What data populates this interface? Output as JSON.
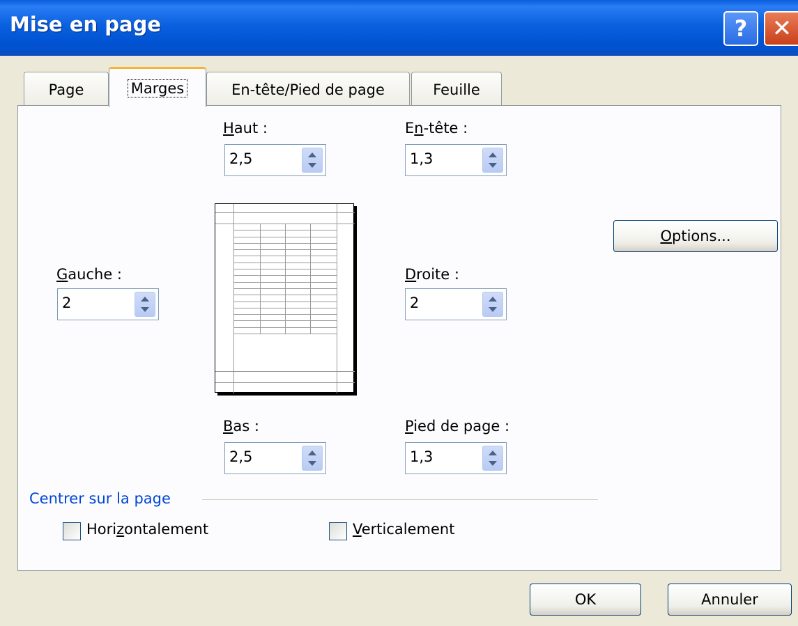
{
  "window": {
    "title": "Mise en page",
    "help_symbol": "?",
    "close_symbol": "✕"
  },
  "tabs": [
    {
      "label": "Page",
      "active": false
    },
    {
      "label": "Marges",
      "active": true
    },
    {
      "label": "En-tête/Pied de page",
      "active": false
    },
    {
      "label": "Feuille",
      "active": false
    }
  ],
  "margins": {
    "top": {
      "label_pre": "",
      "label_mnemonic": "H",
      "label_post": "aut :",
      "value": "2,5"
    },
    "header": {
      "label_pre": "E",
      "label_mnemonic": "n",
      "label_post": "-tête :",
      "value": "1,3"
    },
    "left": {
      "label_pre": "",
      "label_mnemonic": "G",
      "label_post": "auche :",
      "value": "2"
    },
    "right": {
      "label_pre": "",
      "label_mnemonic": "D",
      "label_post": "roite :",
      "value": "2"
    },
    "bottom": {
      "label_pre": "",
      "label_mnemonic": "B",
      "label_post": "as :",
      "value": "2,5"
    },
    "footer": {
      "label_pre": "",
      "label_mnemonic": "P",
      "label_post": "ied de page :",
      "value": "1,3"
    }
  },
  "options_button": {
    "mnemonic": "O",
    "rest": "ptions..."
  },
  "center_group": {
    "title": "Centrer sur la page",
    "horizontal": {
      "pre": "Hori",
      "mnemonic": "z",
      "post": "ontalement",
      "checked": false
    },
    "vertical": {
      "pre": "",
      "mnemonic": "V",
      "post": "erticalement",
      "checked": false
    }
  },
  "buttons": {
    "ok": "OK",
    "cancel": "Annuler"
  },
  "colors": {
    "titlebar": "#0a5edc",
    "group_title": "#0046d5",
    "active_tab_accent": "#f5b336"
  }
}
